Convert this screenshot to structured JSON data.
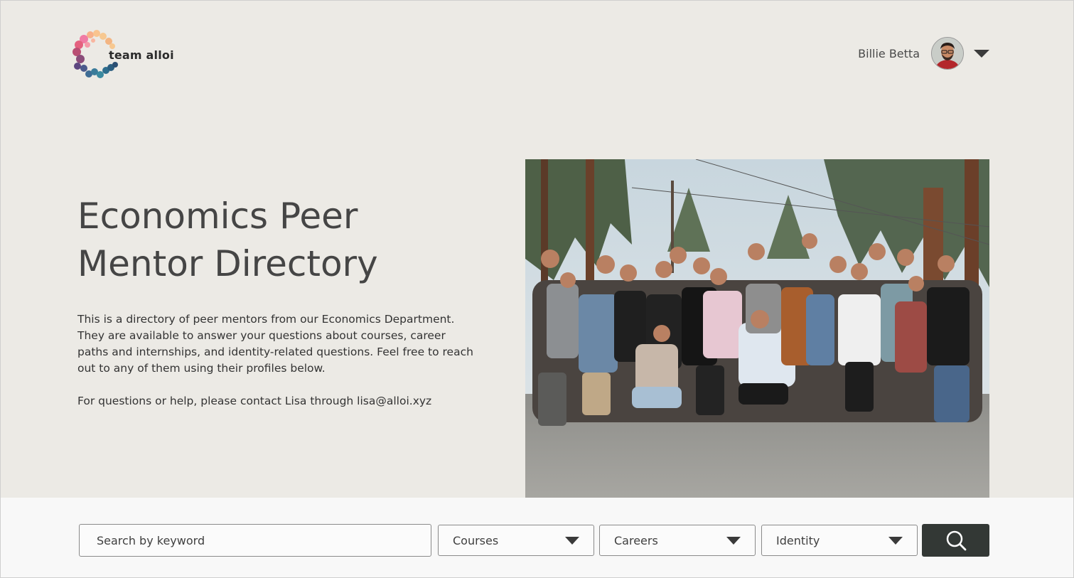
{
  "header": {
    "logo_text": "team alloi",
    "user_name": "Billie Betta"
  },
  "hero": {
    "title_line1": "Economics Peer",
    "title_line2": "Mentor Directory",
    "description": "This is a directory of peer mentors from our Economics Department. They are available to answer your questions about courses, career paths and internships, and identity-related questions. Feel free to reach out to any of them using their profiles below.",
    "contact": "For questions or help, please contact Lisa through lisa@alloi.xyz"
  },
  "search": {
    "placeholder": "Search by keyword",
    "filters": [
      {
        "label": "Courses"
      },
      {
        "label": "Careers"
      },
      {
        "label": "Identity"
      }
    ]
  },
  "icons": {
    "search": "search-icon",
    "chevron": "chevron-down-icon"
  },
  "colors": {
    "background": "#eceae5",
    "search_band": "#f8f8f8",
    "button": "#333835"
  }
}
